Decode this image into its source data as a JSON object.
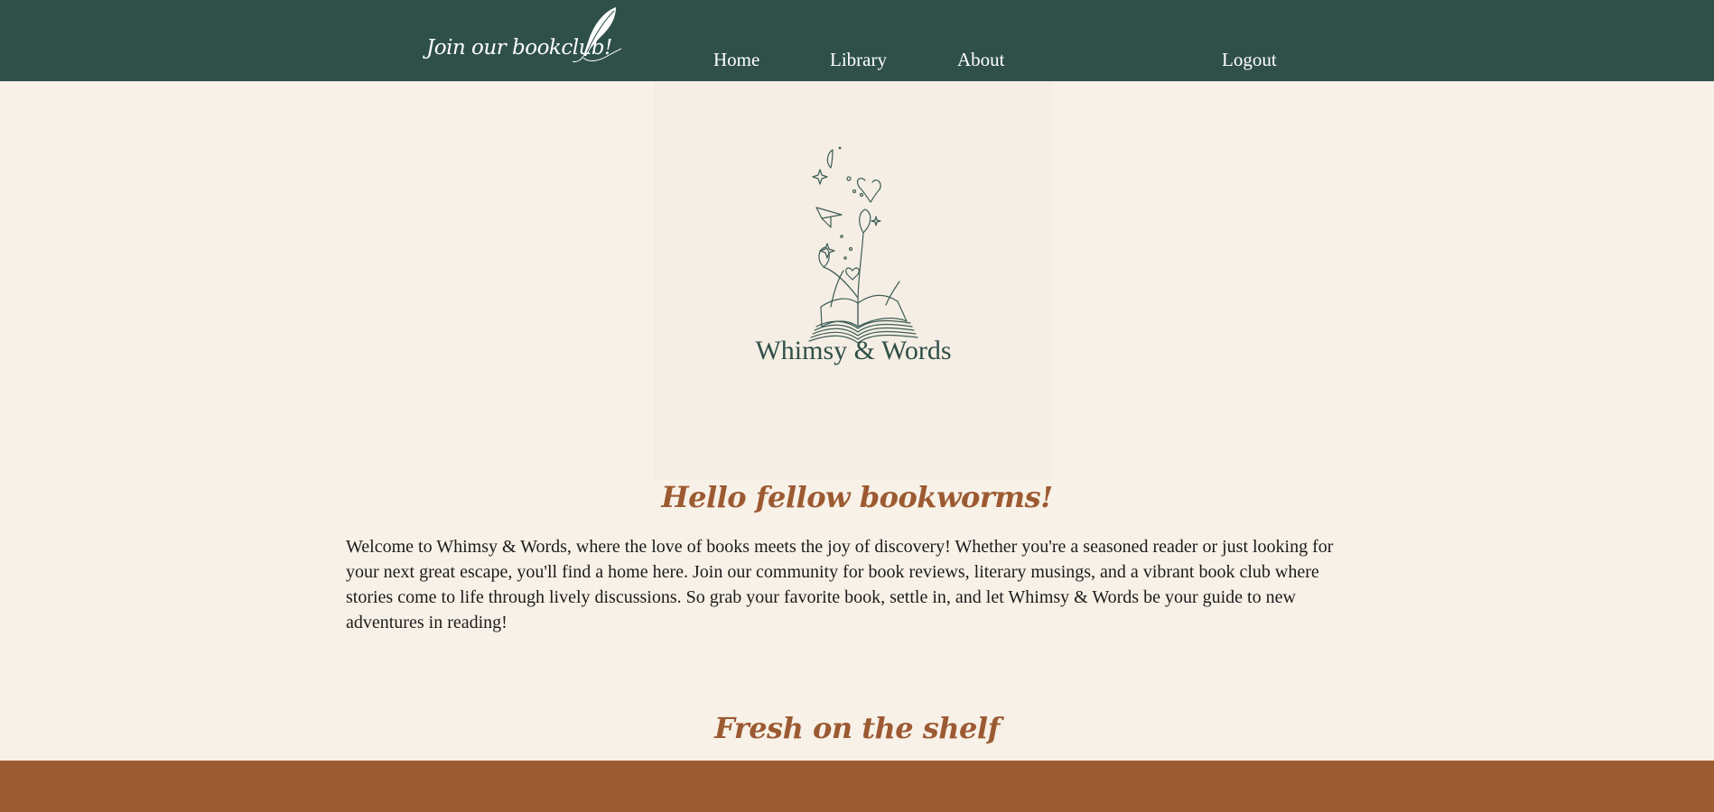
{
  "header": {
    "brand_text": "Join our bookclub!",
    "quill_icon": "quill-feather-icon",
    "nav": [
      {
        "label": "Home"
      },
      {
        "label": "Library"
      },
      {
        "label": "About"
      }
    ],
    "logout_label": "Logout"
  },
  "hero": {
    "logo_icon": "open-book-flowers-icon",
    "title": "Whimsy & Words"
  },
  "main": {
    "greeting": "Hello fellow bookworms!",
    "intro": "Welcome to Whimsy & Words, where the love of books meets the joy of discovery! Whether you're a seasoned reader or just looking for your next great escape, you'll find a home here. Join our community for book reviews, literary musings, and a vibrant book club where stories come to life through lively discussions. So grab your favorite book, settle in, and let Whimsy & Words be your guide to new adventures in reading!",
    "shelf_heading": "Fresh on the shelf"
  },
  "colors": {
    "header_bg": "#2e5049",
    "page_bg": "#f8f1e7",
    "accent": "#9c5a32",
    "footer_bg": "#9c5c33"
  }
}
